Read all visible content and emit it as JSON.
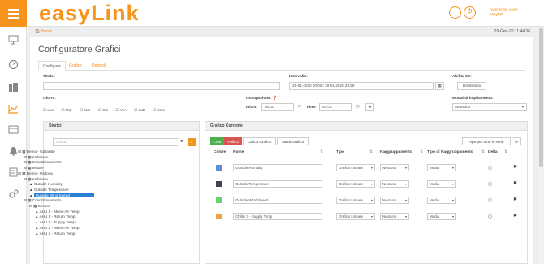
{
  "header": {
    "logo_text": "easyLink",
    "user_line1": "Autenticato come",
    "user_line2": "easylink"
  },
  "breadcrumb": {
    "home": "Home",
    "datetime": "29-Gen-20 11:44:36"
  },
  "page": {
    "title": "Configuratore Grafici"
  },
  "tabs": [
    {
      "label": "Configura"
    },
    {
      "label": "Grafico"
    },
    {
      "label": "Dettagli"
    }
  ],
  "form": {
    "titolo_label": "Titolo:",
    "titolo_value": "",
    "intervallo_label": "Intervallo:",
    "intervallo_value": "29-01-2020 00:00 / 29-01-2020 23:59",
    "abilita3d_label": "Abilita 3D:",
    "abilita3d_value": "Disabilitato",
    "giorni_label": "Giorni:",
    "giorni": [
      "Lun",
      "Mar",
      "Mer",
      "Gio",
      "Ven",
      "Sab",
      "Dom"
    ],
    "occupazione_label": "Occupazione:",
    "inizio_label": "Inizio:",
    "inizio_value": "00:00",
    "fine_label": "Fine:",
    "fine_value": "00:00",
    "modalita_label": "Modalità impilamento:",
    "modalita_value": "Nessuno"
  },
  "storici": {
    "title": "Storici",
    "search_placeholder": "Cerca",
    "tree": [
      {
        "label": "Demo - Gallarate",
        "level": 0
      },
      {
        "label": "Ambiente",
        "level": 1
      },
      {
        "label": "Condizionamento",
        "level": 1
      },
      {
        "label": "Misure",
        "level": 1
      },
      {
        "label": "Demo - Padova",
        "level": 0
      },
      {
        "label": "Ambiente",
        "level": 1
      },
      {
        "label": "Outside Humidity",
        "level": 2
      },
      {
        "label": "Outside Temperature",
        "level": 2
      },
      {
        "label": "Outside Wind Speed",
        "level": 2,
        "selected": true
      },
      {
        "label": "Condizionamento",
        "level": 1
      },
      {
        "label": "Sensori",
        "level": 2
      },
      {
        "label": "AHU 1 - Mixed Air Temp",
        "level": 3
      },
      {
        "label": "AHU 1 - Return Temp",
        "level": 3
      },
      {
        "label": "AHU 1 - Supply Temp",
        "level": 3
      },
      {
        "label": "AHU 2 - Mixed Air Temp",
        "level": 3
      },
      {
        "label": "AHU 2 - Return Temp",
        "level": 3
      }
    ]
  },
  "grafico": {
    "title": "Grafico Corrente",
    "buttons": {
      "crea": "Crea",
      "pulisci": "Pulisci",
      "carica": "Carica Grafico",
      "salva": "Salva Grafico"
    },
    "tipo_tutte": "Tipo per tutte le serie",
    "columns": [
      "Colore",
      "Nome",
      "Tipo",
      "Raggruppamento",
      "Tipo di Raggruppamento",
      "Delta"
    ],
    "rows": [
      {
        "color": "#5b8fd6",
        "name": "Outside Humidity",
        "tipo": "Grafico Lineare",
        "ragg": "Nessuno",
        "tipo_ragg": "Media"
      },
      {
        "color": "#3d4452",
        "name": "Outside Temperature",
        "tipo": "Grafico Lineare",
        "ragg": "Nessuno",
        "tipo_ragg": "Media"
      },
      {
        "color": "#6fcf6f",
        "name": "Outside Wind Speed",
        "tipo": "Grafico Lineare",
        "ragg": "Nessuno",
        "tipo_ragg": "Media"
      },
      {
        "color": "#f0a24a",
        "name": "Chiller 1 - Supply Temp",
        "tipo": "Grafico Lineare",
        "ragg": "Nessuno",
        "tipo_ragg": "Media"
      }
    ]
  },
  "colors": {
    "accent": "#f7941d",
    "selection": "#2a7fd4",
    "green": "#4cae4c",
    "red": "#d9534f"
  }
}
